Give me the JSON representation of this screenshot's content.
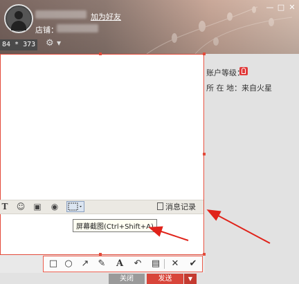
{
  "header": {
    "add_friend": "加为好友",
    "shop_label": "店铺：",
    "minimize": "—",
    "maximize": "□",
    "close": "✕",
    "size_info": "84 * 373",
    "settings_icon": "gear-icon"
  },
  "profile": {
    "level_label": "账户等级：",
    "location": "所 在 地：来自火星"
  },
  "format_bar": {
    "font_icon": "T",
    "emoji_icon": "☺",
    "image_icon": "▣",
    "voice_icon": "◉",
    "history_label": "消息记录"
  },
  "tooltip": {
    "text": "屏幕截图(Ctrl+Shift+A)"
  },
  "screenshot_tools": {
    "rect": "□",
    "ellipse": "○",
    "arrow": "↗",
    "brush": "✎",
    "text": "A",
    "undo": "↶",
    "save": "▤",
    "cancel": "✕",
    "confirm": "✔"
  },
  "bottom": {
    "close_label": "关闭",
    "send_label": "发送",
    "send_dropdown": "▼"
  },
  "colors": {
    "accent": "#e34a3a",
    "send": "#d8453a"
  }
}
